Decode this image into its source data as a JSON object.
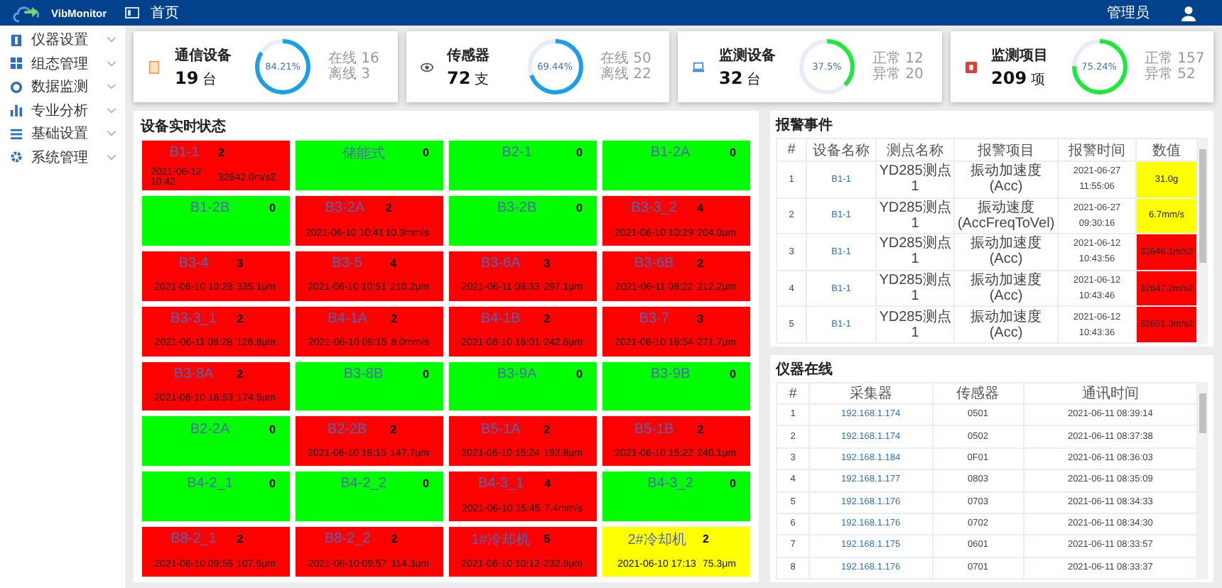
{
  "header": {
    "app_name": "VibMonitor",
    "breadcrumb": "首页",
    "user": "管理员"
  },
  "sidebar": {
    "items": [
      {
        "label": "仪器设置"
      },
      {
        "label": "组态管理"
      },
      {
        "label": "数据监测"
      },
      {
        "label": "专业分析"
      },
      {
        "label": "基础设置"
      },
      {
        "label": "系统管理"
      }
    ]
  },
  "cards": [
    {
      "title": "通信设备",
      "value": "19",
      "unit": "台",
      "percent": "84.21%",
      "level": 0.8421,
      "color": "#1aa0e8",
      "stats": [
        "在线 16",
        "离线 3"
      ]
    },
    {
      "title": "传感器",
      "value": "72",
      "unit": "支",
      "percent": "69.44%",
      "level": 0.6944,
      "color": "#1aa0e8",
      "stats": [
        "在线 50",
        "离线 22"
      ]
    },
    {
      "title": "监测设备",
      "value": "32",
      "unit": "台",
      "percent": "37.5%",
      "level": 0.375,
      "color": "#1ee83c",
      "stats": [
        "正常 12",
        "异常 20"
      ]
    },
    {
      "title": "监测项目",
      "value": "209",
      "unit": "项",
      "percent": "75.24%",
      "level": 0.7524,
      "color": "#1ee83c",
      "stats": [
        "正常 157",
        "异常 52"
      ]
    }
  ],
  "device_status": {
    "title": "设备实时状态",
    "tiles": [
      {
        "name": "B1-1",
        "count": "2",
        "color": "#ff0000",
        "time": "2021-06-12 10:42",
        "reading": "32642.0m/s2"
      },
      {
        "name": "储能式",
        "count": "0",
        "color": "#00ff00"
      },
      {
        "name": "B2-1",
        "count": "0",
        "color": "#00ff00"
      },
      {
        "name": "B1-2A",
        "count": "0",
        "color": "#00ff00"
      },
      {
        "name": "B1-2B",
        "count": "0",
        "color": "#00ff00"
      },
      {
        "name": "B3-2A",
        "count": "2",
        "color": "#ff0000",
        "time": "2021-06-10 10:41",
        "reading": "10.9mm/s"
      },
      {
        "name": "B3-2B",
        "count": "0",
        "color": "#00ff00"
      },
      {
        "name": "B3-3_2",
        "count": "4",
        "color": "#ff0000",
        "time": "2021-06-10 10:29",
        "reading": "204.0μm"
      },
      {
        "name": "B3-4",
        "count": "3",
        "color": "#ff0000",
        "time": "2021-06-10 10:28",
        "reading": "335.1μm"
      },
      {
        "name": "B3-5",
        "count": "4",
        "color": "#ff0000",
        "time": "2021-06-10 10:51",
        "reading": "210.2μm"
      },
      {
        "name": "B3-6A",
        "count": "3",
        "color": "#ff0000",
        "time": "2021-06-11 08:33",
        "reading": "297.1μm"
      },
      {
        "name": "B3-6B",
        "count": "2",
        "color": "#ff0000",
        "time": "2021-06-11 08:22",
        "reading": "212.2μm"
      },
      {
        "name": "B3-3_1",
        "count": "2",
        "color": "#ff0000",
        "time": "2021-06-11 08:28",
        "reading": "126.8μm"
      },
      {
        "name": "B4-1A",
        "count": "2",
        "color": "#ff0000",
        "time": "2021-06-10 09:15",
        "reading": "8.0mm/s"
      },
      {
        "name": "B4-1B",
        "count": "2",
        "color": "#ff0000",
        "time": "2021-06-10 16:01",
        "reading": "242.6μm"
      },
      {
        "name": "B3-7",
        "count": "3",
        "color": "#ff0000",
        "time": "2021-06-10 16:54",
        "reading": "271.7μm"
      },
      {
        "name": "B3-8A",
        "count": "2",
        "color": "#ff0000",
        "time": "2021-06-10 16:53",
        "reading": "174.5μm"
      },
      {
        "name": "B3-8B",
        "count": "0",
        "color": "#00ff00"
      },
      {
        "name": "B3-9A",
        "count": "0",
        "color": "#00ff00"
      },
      {
        "name": "B3-9B",
        "count": "0",
        "color": "#00ff00"
      },
      {
        "name": "B2-2A",
        "count": "0",
        "color": "#00ff00"
      },
      {
        "name": "B2-2B",
        "count": "2",
        "color": "#ff0000",
        "time": "2021-06-10 16:15",
        "reading": "147.7μm"
      },
      {
        "name": "B5-1A",
        "count": "2",
        "color": "#ff0000",
        "time": "2021-06-10 15:24",
        "reading": "192.8μm"
      },
      {
        "name": "B5-1B",
        "count": "2",
        "color": "#ff0000",
        "time": "2021-06-10 15:22",
        "reading": "240.1μm"
      },
      {
        "name": "B4-2_1",
        "count": "0",
        "color": "#00ff00"
      },
      {
        "name": "B4-2_2",
        "count": "0",
        "color": "#00ff00"
      },
      {
        "name": "B4-3_1",
        "count": "4",
        "color": "#ff0000",
        "time": "2021-06-10 15:45",
        "reading": "7.4mm/s"
      },
      {
        "name": "B4-3_2",
        "count": "0",
        "color": "#00ff00"
      },
      {
        "name": "B8-2_1",
        "count": "2",
        "color": "#ff0000",
        "time": "2021-06-10 09:56",
        "reading": "107.5μm"
      },
      {
        "name": "B8-2_2",
        "count": "2",
        "color": "#ff0000",
        "time": "2021-06-10 09:57",
        "reading": "114.3μm"
      },
      {
        "name": "1#冷却机",
        "count": "5",
        "color": "#ff0000",
        "time": "2021-06-10 10:12",
        "reading": "232.9μm"
      },
      {
        "name": "2#冷却机",
        "count": "2",
        "color": "#ffff00",
        "time": "2021-06-10 17:13",
        "reading": "75.3μm"
      }
    ]
  },
  "alarm_events": {
    "title": "报警事件",
    "columns": [
      "#",
      "设备名称",
      "测点名称",
      "报警项目",
      "报警时间",
      "数值"
    ],
    "rows": [
      {
        "cells": [
          "1",
          "B1-1",
          "YD285测点1",
          "振动加速度(Acc)",
          "2021-06-27 11:55:06",
          "31.0g"
        ],
        "color": "#ffff00"
      },
      {
        "cells": [
          "2",
          "B1-1",
          "YD285测点1",
          "振动速度(AccFreqToVel)",
          "2021-06-27 09:30:16",
          "6.7mm/s"
        ],
        "color": "#ffff00"
      },
      {
        "cells": [
          "3",
          "B1-1",
          "YD285测点1",
          "振动加速度(Acc)",
          "2021-06-12 10:43:56",
          "32646.1m/s2"
        ],
        "color": "#ff0000"
      },
      {
        "cells": [
          "4",
          "B1-1",
          "YD285测点1",
          "振动加速度(Acc)",
          "2021-06-12 10:43:46",
          "32647.2m/s2"
        ],
        "color": "#ff0000"
      },
      {
        "cells": [
          "5",
          "B1-1",
          "YD285测点1",
          "振动加速度(Acc)",
          "2021-06-12 10:43:36",
          "32651.0m/s2"
        ],
        "color": "#ff0000"
      }
    ]
  },
  "instruments_online": {
    "title": "仪器在线",
    "columns": [
      "#",
      "采集器",
      "传感器",
      "通讯时间"
    ],
    "rows": [
      [
        "1",
        "192.168.1.174",
        "0501",
        "2021-06-11 08:39:14"
      ],
      [
        "2",
        "192.168.1.174",
        "0502",
        "2021-06-11 08:37:38"
      ],
      [
        "3",
        "192.168.1.184",
        "0F01",
        "2021-06-11 08:36:03"
      ],
      [
        "4",
        "192.168.1.177",
        "0803",
        "2021-06-11 08:35:09"
      ],
      [
        "5",
        "192.168.1.176",
        "0703",
        "2021-06-11 08:34:33"
      ],
      [
        "6",
        "192.168.1.176",
        "0702",
        "2021-06-11 08:34:30"
      ],
      [
        "7",
        "192.168.1.175",
        "0601",
        "2021-06-11 08:33:57"
      ],
      [
        "8",
        "192.168.1.176",
        "0701",
        "2021-06-11 08:33:37"
      ]
    ]
  }
}
